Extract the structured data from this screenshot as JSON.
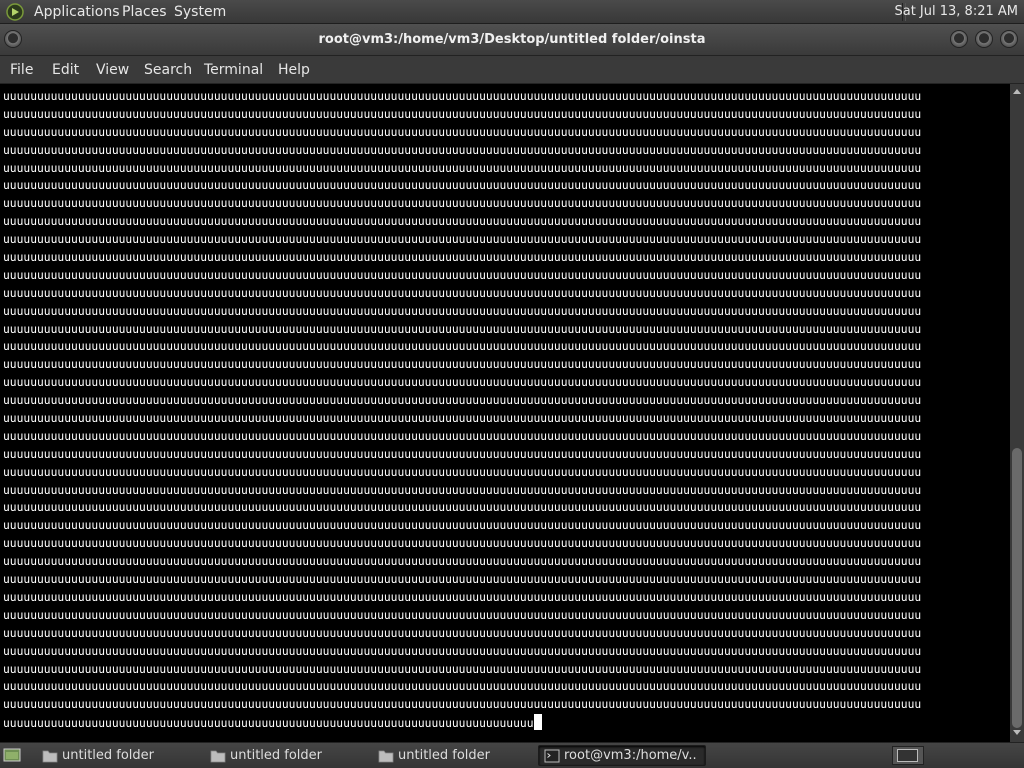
{
  "top_panel": {
    "menus": [
      "Applications",
      "Places",
      "System"
    ],
    "clock": "Sat Jul 13,  8:21 AM"
  },
  "window": {
    "title": "root@vm3:/home/vm3/Desktop/untitled folder/oinsta"
  },
  "menubar": [
    "File",
    "Edit",
    "View",
    "Search",
    "Terminal",
    "Help"
  ],
  "terminal": {
    "full_line": "uuuuuuuuuuuuuuuuuuuuuuuuuuuuuuuuuuuuuuuuuuuuuuuuuuuuuuuuuuuuuuuuuuuuuuuuuuuuuuuuuuuuuuuuuuuuuuuuuuuuuuuuuuuuuuuuuuuuuuuuuuuuuuuuuuuuuuu",
    "full_line_count": 35,
    "last_line": "uuuuuuuuuuuuuuuuuuuuuuuuuuuuuuuuuuuuuuuuuuuuuuuuuuuuuuuuuuuuuuuuuuuuuuuuuuuuuu"
  },
  "taskbar": {
    "tasks": [
      {
        "label": "untitled folder",
        "icon": "folder-icon",
        "active": false
      },
      {
        "label": "untitled folder",
        "icon": "folder-icon",
        "active": false
      },
      {
        "label": "untitled folder",
        "icon": "folder-icon",
        "active": false
      },
      {
        "label": "root@vm3:/home/v...",
        "icon": "terminal-icon",
        "active": true
      }
    ]
  },
  "colors": {
    "terminal_bg": "#000000",
    "terminal_fg": "#ffffff",
    "panel_bg": "#3a3a3a"
  }
}
